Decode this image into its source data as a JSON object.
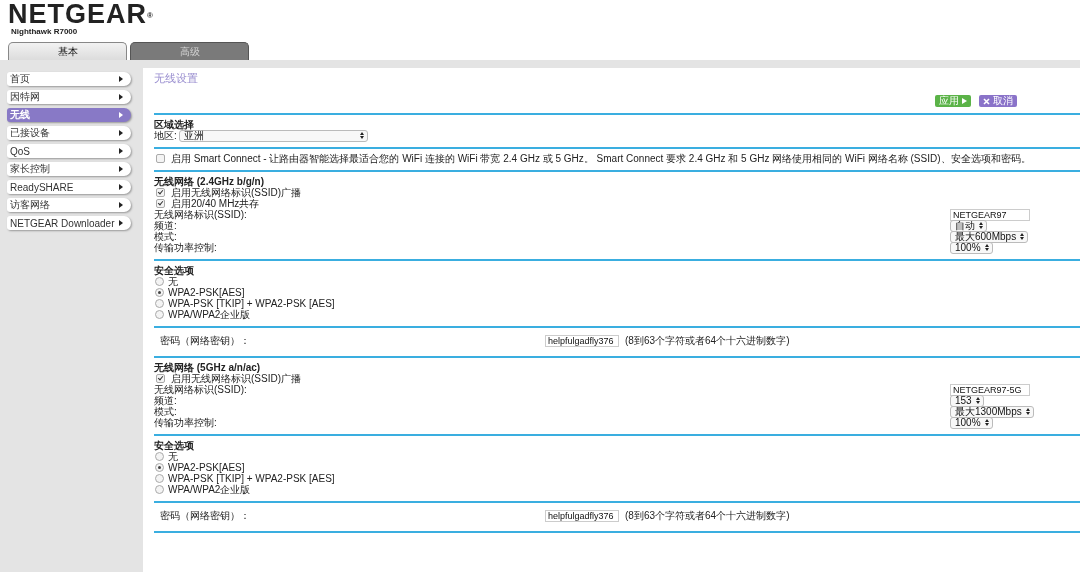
{
  "brand": {
    "logo": "NETGEAR$^{®}$",
    "model": "Nighthawk R7000"
  },
  "tabs": [
    {
      "label": "基本",
      "selected": true
    },
    {
      "label": "高级",
      "selected": false
    }
  ],
  "sidebar": {
    "items": [
      {
        "label": "首页",
        "selected": false
      },
      {
        "label": "因特网",
        "selected": false
      },
      {
        "label": "无线",
        "selected": true
      },
      {
        "label": "已接设备",
        "selected": false
      },
      {
        "label": "QoS",
        "selected": false
      },
      {
        "label": "家长控制",
        "selected": false
      },
      {
        "label": "ReadySHARE",
        "selected": false
      },
      {
        "label": "访客网络",
        "selected": false
      },
      {
        "label": "NETGEAR Downloader",
        "selected": false
      }
    ]
  },
  "page": {
    "title": "无线设置",
    "buttons": [
      {
        "label": "应用",
        "kind": "apply"
      },
      {
        "label": "取消",
        "kind": "cancel"
      }
    ]
  },
  "region": {
    "heading": "区域选择",
    "label": "地区:",
    "value": "亚洲"
  },
  "smart_connect": {
    "checked": false,
    "label": "启用 Smart Connect - 让路由器智能选择最适合您的 WiFi 连接的 WiFi 带宽 2.4 GHz 或 5 GHz。 Smart Connect 要求 2.4 GHz 和 5 GHz 网络使用相同的 WiFi 网络名称 (SSID)、安全选项和密码。"
  },
  "networks": [
    {
      "heading": "无线网络 (2.4GHz b/g/n)",
      "options": [
        {
          "label": "启用无线网络标识(SSID)广播",
          "checked": true
        },
        {
          "label": "启用20/40 MHz共存",
          "checked": true
        }
      ],
      "fields": [
        {
          "label": "无线网络标识(SSID):",
          "kind": "text",
          "value": "NETGEAR97"
        },
        {
          "label": "频道:",
          "kind": "select",
          "value": "自动"
        },
        {
          "label": "模式:",
          "kind": "select",
          "value": "最大600Mbps"
        },
        {
          "label": "传输功率控制:",
          "kind": "select",
          "value": "100%"
        }
      ],
      "security": {
        "heading": "安全选项",
        "options": [
          {
            "label": "无",
            "selected": false
          },
          {
            "label": "WPA2-PSK[AES]",
            "selected": true
          },
          {
            "label": "WPA-PSK [TKIP] + WPA2-PSK [AES]",
            "selected": false
          },
          {
            "label": "WPA/WPA2企业版",
            "selected": false
          }
        ]
      },
      "password": {
        "label": "密码（网络密钥）：",
        "value": "helpfulgadfly376",
        "hint": "(8到63个字符或者64个十六进制数字)"
      }
    },
    {
      "heading": "无线网络 (5GHz a/n/ac)",
      "options": [
        {
          "label": "启用无线网络标识(SSID)广播",
          "checked": true
        }
      ],
      "fields": [
        {
          "label": "无线网络标识(SSID):",
          "kind": "text",
          "value": "NETGEAR97-5G"
        },
        {
          "label": "频道:",
          "kind": "select",
          "value": "153"
        },
        {
          "label": "模式:",
          "kind": "select",
          "value": "最大1300Mbps"
        },
        {
          "label": "传输功率控制:",
          "kind": "select",
          "value": "100%"
        }
      ],
      "security": {
        "heading": "安全选项",
        "options": [
          {
            "label": "无",
            "selected": false
          },
          {
            "label": "WPA2-PSK[AES]",
            "selected": true
          },
          {
            "label": "WPA-PSK [TKIP] + WPA2-PSK [AES]",
            "selected": false
          },
          {
            "label": "WPA/WPA2企业版",
            "selected": false
          }
        ]
      },
      "password": {
        "label": "密码（网络密钥）：",
        "value": "helpfulgadfly376",
        "hint": "(8到63个字符或者64个十六进制数字)"
      }
    }
  ]
}
